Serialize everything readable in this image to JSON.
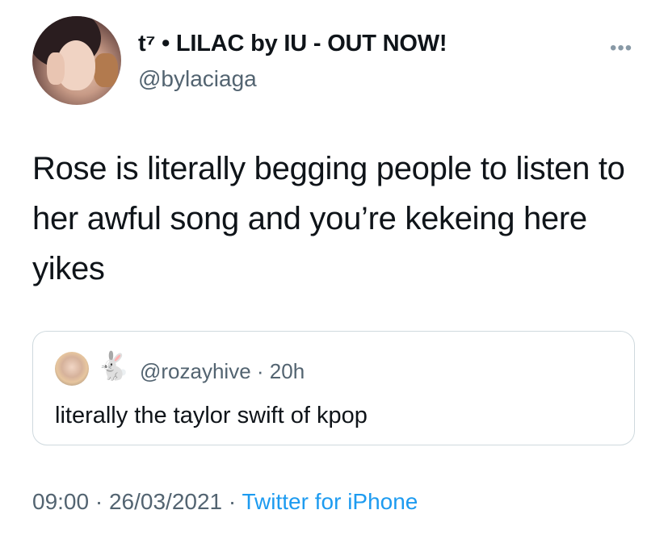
{
  "author": {
    "display_name": "t⁷ • LILAC by IU - OUT NOW!",
    "handle": "@bylaciaga"
  },
  "more_icon": "more-horizontal-icon",
  "tweet": {
    "text": "Rose is literally begging people to listen to her awful song and you’re kekeing here yikes"
  },
  "quoted_tweet": {
    "emoji": "🐇",
    "handle": "@rozayhive",
    "separator": " · ",
    "time": "20h",
    "text": "literally the taylor swift of kpop"
  },
  "meta": {
    "time": "09:00",
    "sep1": " · ",
    "date": "26/03/2021",
    "sep2": " · ",
    "source": "Twitter for iPhone"
  },
  "colors": {
    "text": "#0f1419",
    "secondary": "#536471",
    "link": "#1d9bf0",
    "border": "#cfd9de"
  }
}
